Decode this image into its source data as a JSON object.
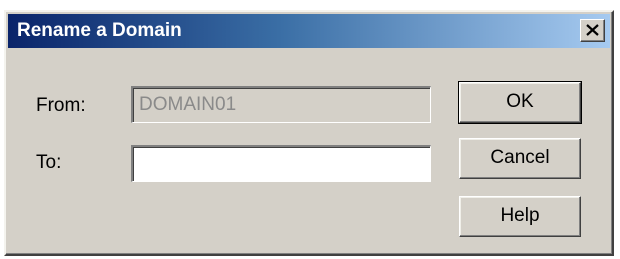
{
  "dialog": {
    "title": "Rename a Domain",
    "close_label": "×"
  },
  "form": {
    "from_label": "From:",
    "from_value": "DOMAIN01",
    "to_label": "To:",
    "to_value": ""
  },
  "buttons": {
    "ok": "OK",
    "cancel": "Cancel",
    "help": "Help"
  },
  "colors": {
    "titlebar_start": "#0a246a",
    "titlebar_end": "#a6caf0",
    "dialog_bg": "#d4d0c8"
  }
}
